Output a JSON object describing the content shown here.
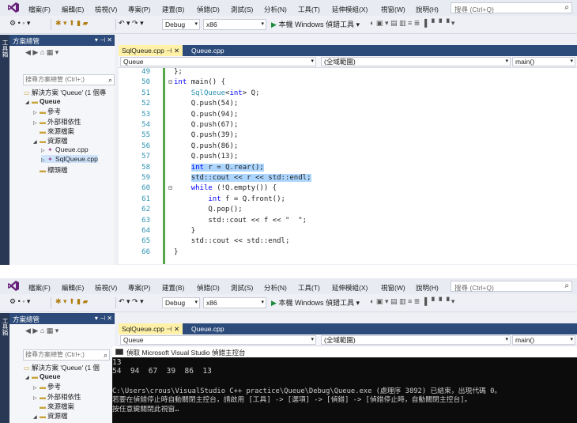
{
  "menu": [
    "檔案(F)",
    "編輯(E)",
    "檢視(V)",
    "專案(P)",
    "建置(B)",
    "偵錯(D)",
    "測試(S)",
    "分析(N)",
    "工具(T)",
    "延伸模組(X)",
    "視窗(W)",
    "說明(H)"
  ],
  "search_placeholder": "搜尋 (Ctrl+Q)",
  "toolbar": {
    "config": "Debug",
    "platform": "x86",
    "run_label": "本機 Windows 偵錯工具"
  },
  "dock_label": "工具箱",
  "solution_explorer": {
    "title": "方案總管",
    "title_controls": "▾ ⊣ ✕",
    "search_placeholder": "搜尋方案總管 (Ctrl+;)",
    "items_top": [
      {
        "label": "解決方案 'Queue' (1 個專",
        "indent": 0
      },
      {
        "label": "Queue",
        "indent": 1,
        "bold": true
      },
      {
        "label": "參考",
        "indent": 2
      },
      {
        "label": "外部相依性",
        "indent": 2
      },
      {
        "label": "來源檔案",
        "indent": 2
      },
      {
        "label": "資源檔",
        "indent": 2
      },
      {
        "label": "Queue.cpp",
        "indent": 3
      },
      {
        "label": "SqlQueue.cpp",
        "indent": 3,
        "selected": true
      },
      {
        "label": "標頭檔",
        "indent": 2
      }
    ],
    "items_bottom": [
      {
        "label": "解決方案 'Queue' (1 個",
        "indent": 0
      },
      {
        "label": "Queue",
        "indent": 1,
        "bold": true
      },
      {
        "label": "參考",
        "indent": 2
      },
      {
        "label": "外部相依性",
        "indent": 2
      },
      {
        "label": "來源檔案",
        "indent": 2
      },
      {
        "label": "資源檔",
        "indent": 2
      }
    ]
  },
  "tabs": {
    "active": "SqlQueue.cpp",
    "active_controls": "⊣ ✕",
    "other": "Queue.cpp"
  },
  "nav": {
    "project": "Queue",
    "scope": "(全域範圍)",
    "member": "main()"
  },
  "code_lines": [
    {
      "n": "49",
      "text": "};"
    },
    {
      "n": "50",
      "text": "int main() {"
    },
    {
      "n": "51",
      "text": "    SqlQueue<int> Q;"
    },
    {
      "n": "52",
      "text": "    Q.push(54);"
    },
    {
      "n": "53",
      "text": "    Q.push(94);"
    },
    {
      "n": "54",
      "text": "    Q.push(67);"
    },
    {
      "n": "55",
      "text": "    Q.push(39);"
    },
    {
      "n": "56",
      "text": "    Q.push(86);"
    },
    {
      "n": "57",
      "text": "    Q.push(13);"
    },
    {
      "n": "58",
      "text": "    int r = Q.rear();"
    },
    {
      "n": "59",
      "text": "    std::cout << r << std::endl;"
    },
    {
      "n": "60",
      "text": "    while (!Q.empty()) {"
    },
    {
      "n": "61",
      "text": "        int f = Q.front();"
    },
    {
      "n": "62",
      "text": "        Q.pop();"
    },
    {
      "n": "63",
      "text": "        std::cout << f << \"  \";"
    },
    {
      "n": "64",
      "text": "    }"
    },
    {
      "n": "65",
      "text": "    std::cout << std::endl;"
    },
    {
      "n": "66",
      "text": "}"
    }
  ],
  "console": {
    "title": "偵取 Microsoft Visual Studio 偵錯主控台",
    "lines": [
      "13",
      "54  94  67  39  86  13",
      "",
      "C:\\Users\\crous\\VisualStudio C++ practice\\Queue\\Debug\\Queue.exe (處理序 3892) 已結束，出現代碼 0。",
      "若要在偵錯停止時自動關閉主控台，請啟用 [工具] -> [選項] -> [偵錯] -> [偵錯停止時，自動關閉主控台]。",
      "按任意鍵關閉此視窗…"
    ]
  },
  "colors": {
    "title_blue": "#2d4b7a",
    "tab_active": "#fff2a8",
    "keyword": "#0000ff",
    "type": "#2b91af",
    "selection": "#add6ff",
    "change_bar": "#57a64a"
  }
}
